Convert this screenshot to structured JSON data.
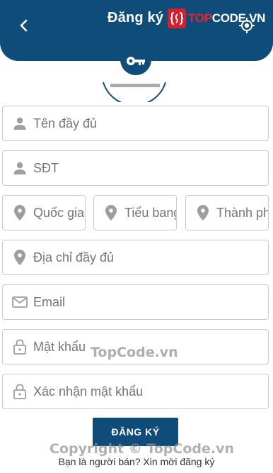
{
  "header": {
    "title": "Đăng ký",
    "logo": {
      "prefix": "TOP",
      "suffix": "CODE.VN"
    }
  },
  "form": {
    "full_name": {
      "placeholder": "Tên đầy đủ",
      "value": ""
    },
    "phone": {
      "placeholder": "SĐT",
      "value": ""
    },
    "country": {
      "placeholder": "Quốc gia",
      "value": ""
    },
    "state": {
      "placeholder": "Tiểu bang",
      "value": ""
    },
    "city": {
      "placeholder": "Thành phố",
      "value": ""
    },
    "address": {
      "placeholder": "Địa chỉ đầy đủ",
      "value": ""
    },
    "email": {
      "placeholder": "Email",
      "value": ""
    },
    "password": {
      "placeholder": "Mật khẩu",
      "value": ""
    },
    "confirm_password": {
      "placeholder": "Xác nhận mật khẩu",
      "value": ""
    },
    "submit_label": "ĐĂNG KÝ"
  },
  "footer": {
    "seller_link": "Bạn là người bán? Xin mời đăng ký"
  },
  "watermarks": {
    "middle": "TopCode.vn",
    "bottom": "Copyright © TopCode.vn"
  },
  "colors": {
    "primary": "#0f4c7a",
    "icon_gray": "#9e9e9e",
    "logo_red": "#d3202f"
  },
  "icons": {
    "back": "chevron-left-icon",
    "locate": "gps-target-icon",
    "key": "key-icon",
    "person": "person-icon",
    "location": "map-pin-icon",
    "email": "mail-icon",
    "lock": "lock-icon"
  }
}
